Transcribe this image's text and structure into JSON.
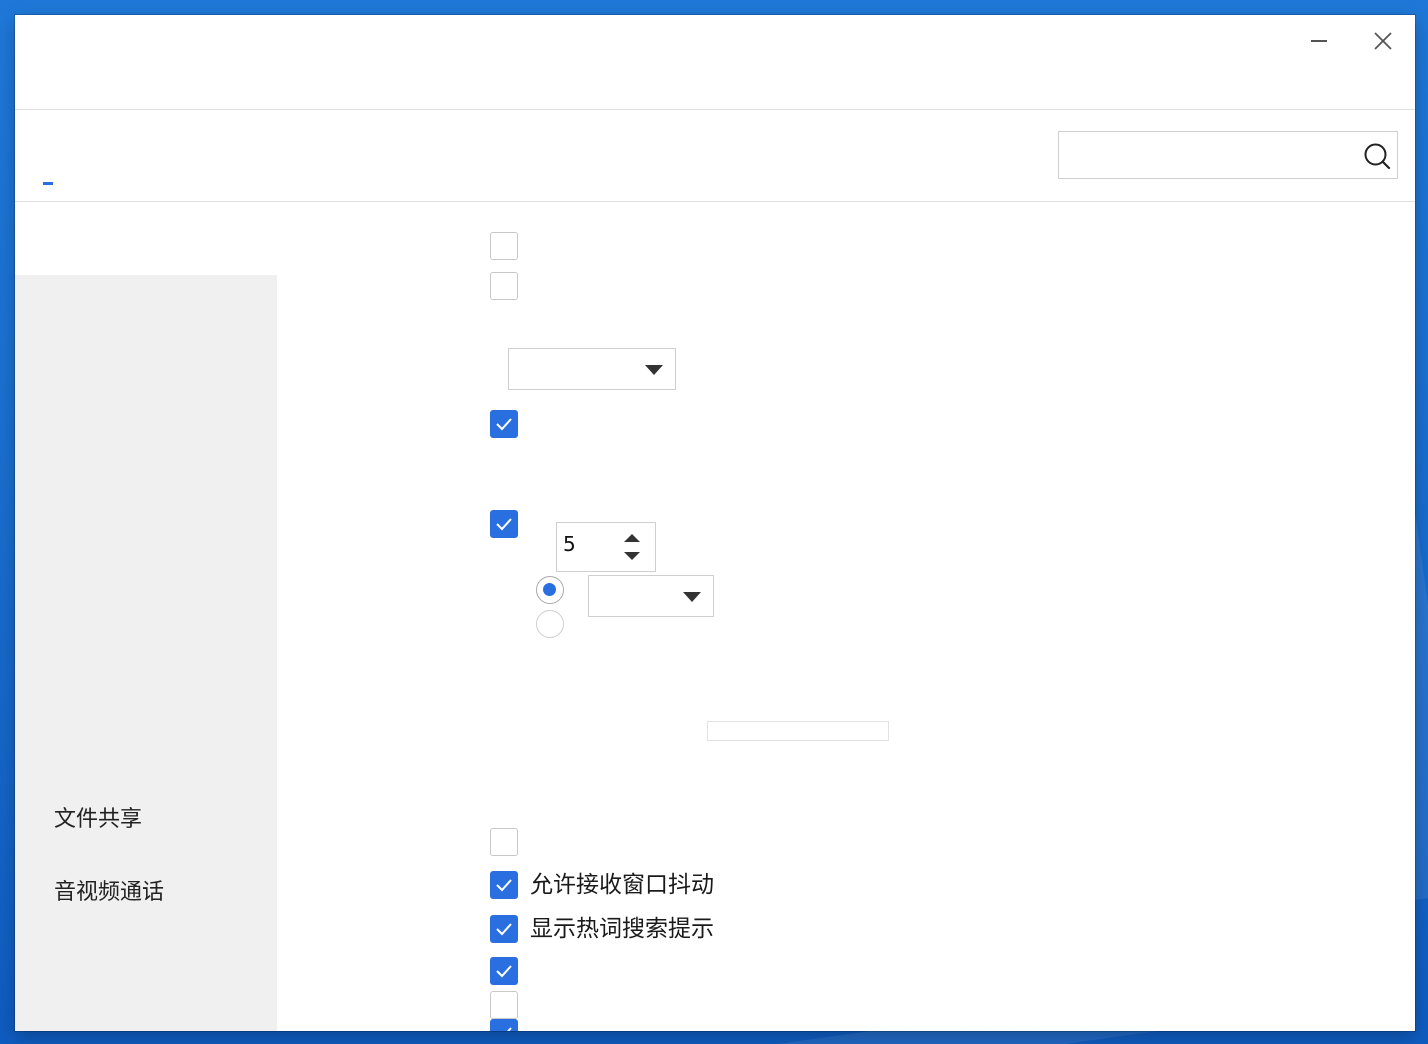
{
  "window": {
    "title": "",
    "controls": {
      "minimize_icon": "minimize-icon",
      "close_icon": "close-icon"
    }
  },
  "tabbar": {
    "active_tab_label": "",
    "search": {
      "value": "",
      "placeholder": "",
      "icon": "search-icon"
    }
  },
  "sidebar": {
    "items": [
      {
        "label": "文件共享"
      },
      {
        "label": "音视频通话"
      }
    ]
  },
  "settings": {
    "checkbox_1": {
      "label": "",
      "checked": false
    },
    "checkbox_2": {
      "label": "",
      "checked": false
    },
    "dropdown_1": {
      "value": ""
    },
    "checkbox_3": {
      "label": "",
      "checked": true
    },
    "checkbox_4": {
      "label": "",
      "checked": true
    },
    "spinner": {
      "value": "5"
    },
    "radio_1": {
      "label": "",
      "selected": true
    },
    "dropdown_2": {
      "value": ""
    },
    "radio_2": {
      "label": "",
      "selected": false
    },
    "text_field": {
      "value": ""
    },
    "checkbox_5": {
      "label": "",
      "checked": false
    },
    "checkbox_shake": {
      "label": "允许接收窗口抖动",
      "checked": true
    },
    "checkbox_hotword": {
      "label": "显示热词搜索提示",
      "checked": true
    },
    "checkbox_6": {
      "label": "",
      "checked": true
    },
    "checkbox_7": {
      "label": "",
      "checked": false
    },
    "checkbox_8": {
      "label": "",
      "checked": true
    }
  },
  "colors": {
    "accent": "#2a6fe0",
    "sidebar_bg": "#f0f0f0",
    "desktop_bg": "#1a6fd0"
  }
}
